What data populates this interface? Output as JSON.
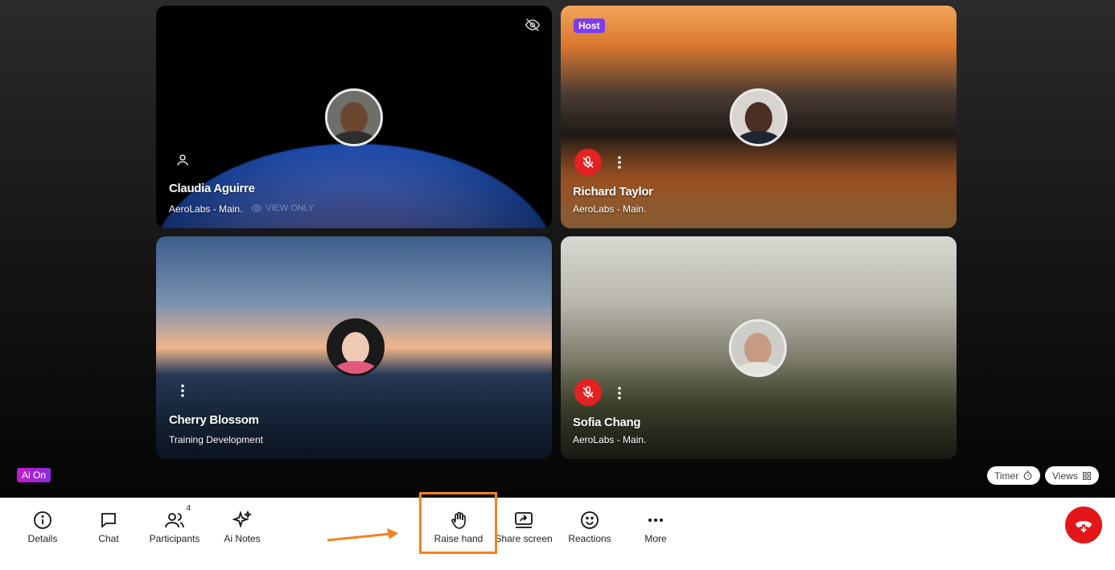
{
  "participants": [
    {
      "name": "Claudia Aguirre",
      "org": "AeroLabs - Main.",
      "view_only": "VIEW ONLY"
    },
    {
      "name": "Richard Taylor",
      "org": "AeroLabs - Main.",
      "badge": "Host"
    },
    {
      "name": "Cherry Blossom",
      "org": "Training Development"
    },
    {
      "name": "Sofia Chang",
      "org": "AeroLabs - Main."
    }
  ],
  "ai_badge": "Ai On",
  "timer_label": "Timer",
  "views_label": "Views",
  "toolbar": {
    "details": "Details",
    "chat": "Chat",
    "participants": "Participants",
    "participants_count": "4",
    "ai_notes": "Ai Notes",
    "raise_hand": "Raise hand",
    "share_screen": "Share screen",
    "reactions": "Reactions",
    "more": "More"
  },
  "colors": {
    "accent_highlight": "#f58220",
    "host_badge": "#7b3cf0",
    "mute_red": "#e32222",
    "end_call": "#e3161a"
  }
}
